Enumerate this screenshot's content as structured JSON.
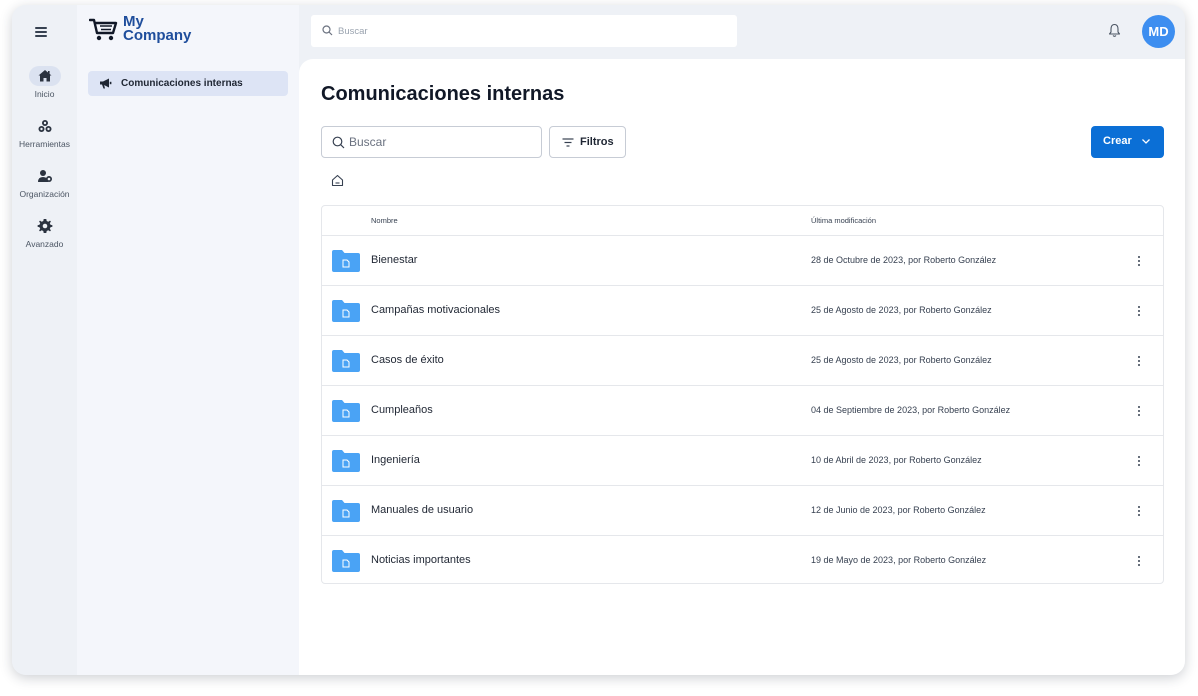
{
  "app": {
    "brand_line1": "My",
    "brand_line2": "Company",
    "logo_icon": "shopping-cart-icon"
  },
  "topbar": {
    "search_placeholder": "Buscar",
    "notifications_icon": "bell-icon",
    "avatar_initials": "MD",
    "avatar_color": "#3d8ef0"
  },
  "rail": {
    "menu_icon": "hamburger-icon",
    "items": [
      {
        "label": "Inicio",
        "icon": "home-icon",
        "active": true
      },
      {
        "label": "Herramientas",
        "icon": "tools-icon",
        "active": false
      },
      {
        "label": "Organización",
        "icon": "users-icon",
        "active": false
      },
      {
        "label": "Avanzado",
        "icon": "gear-icon",
        "active": false
      }
    ]
  },
  "subnav": {
    "items": [
      {
        "label": "Comunicaciones internas",
        "icon": "megaphone-icon",
        "active": true
      }
    ]
  },
  "main": {
    "title": "Comunicaciones internas",
    "search_placeholder": "Buscar",
    "filter_label": "Filtros",
    "create_label": "Crear",
    "breadcrumb_icon": "home-icon",
    "accent_color": "#0b6fd6",
    "folder_color": "#4aa3f5",
    "columns": {
      "name": "Nombre",
      "modified": "Última modificación"
    },
    "rows": [
      {
        "name": "Bienestar",
        "modified": "28 de Octubre de 2023, por Roberto González"
      },
      {
        "name": "Campañas motivacionales",
        "modified": "25 de Agosto de 2023, por Roberto González"
      },
      {
        "name": "Casos de éxito",
        "modified": "25 de Agosto de 2023, por Roberto González"
      },
      {
        "name": "Cumpleaños",
        "modified": "04 de Septiembre de 2023, por Roberto González"
      },
      {
        "name": "Ingeniería",
        "modified": "10 de Abril de 2023, por Roberto González"
      },
      {
        "name": "Manuales de usuario",
        "modified": "12 de Junio de 2023, por Roberto González"
      },
      {
        "name": "Noticias importantes",
        "modified": "19 de Mayo de 2023, por Roberto González"
      }
    ]
  }
}
